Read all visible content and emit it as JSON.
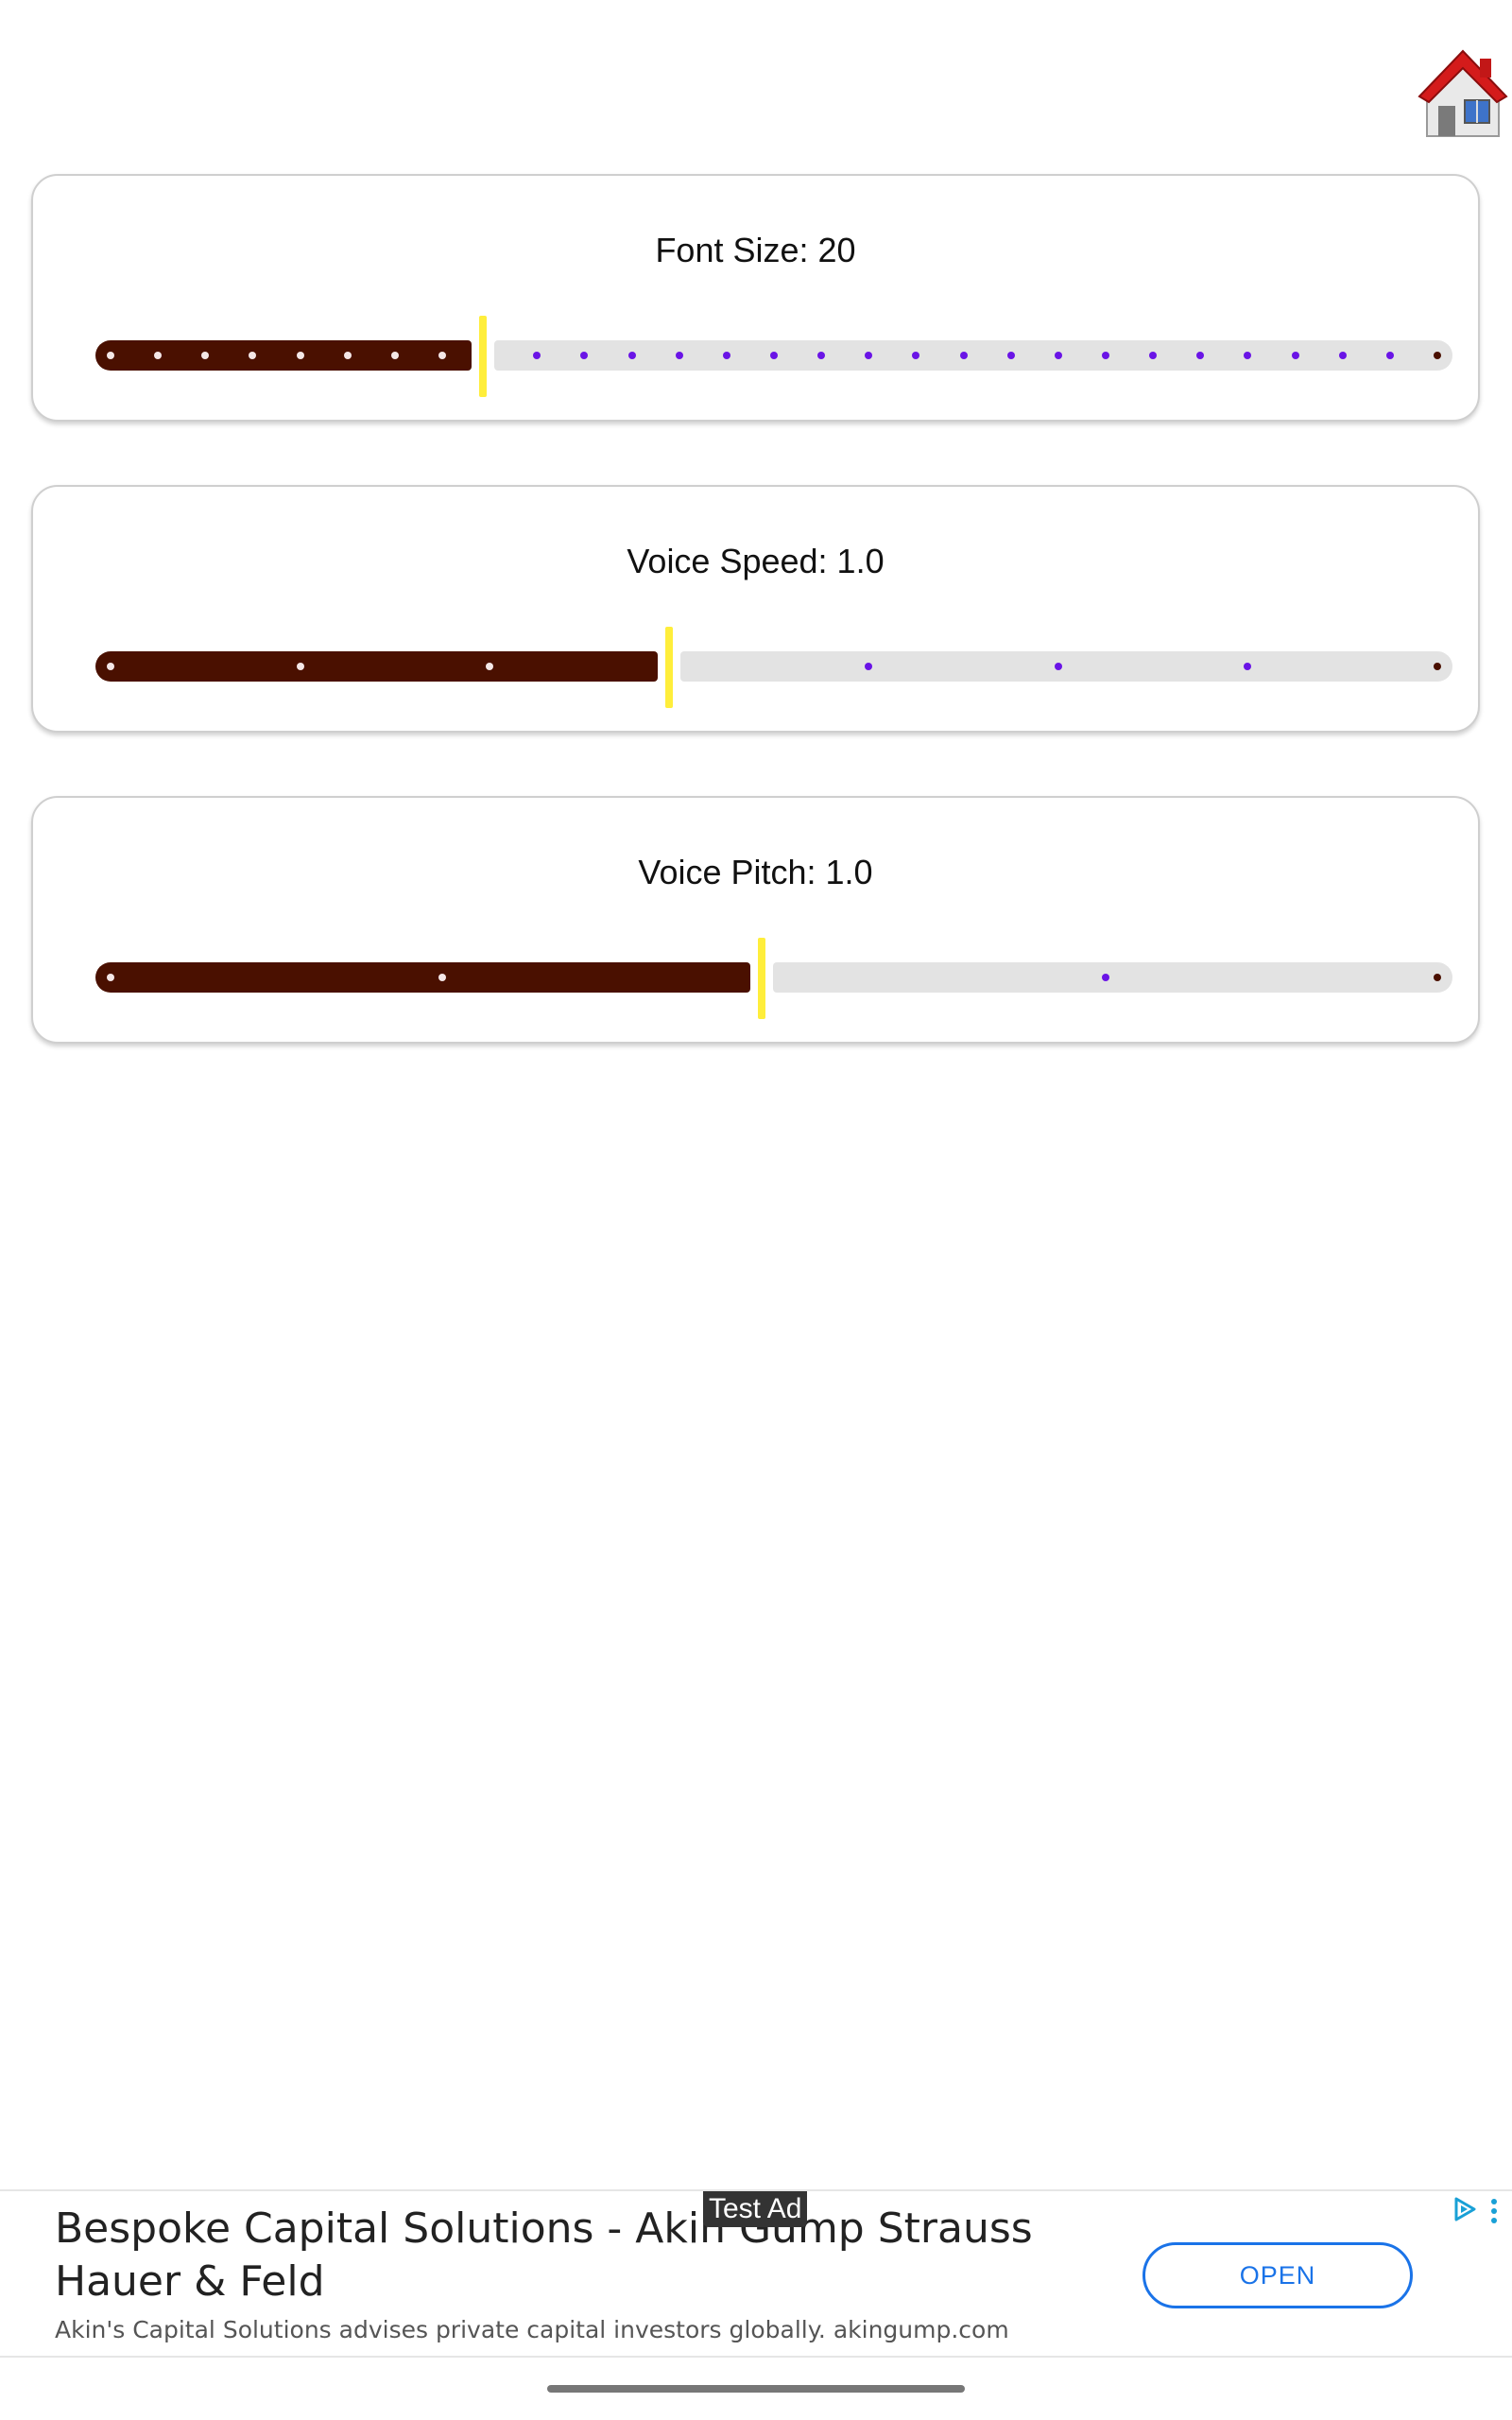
{
  "header": {
    "home_icon": "home-icon"
  },
  "settings": [
    {
      "label": "Font Size: 20",
      "value_fraction": 0.28,
      "steps": 28
    },
    {
      "label": "Voice Speed: 1.0",
      "value_fraction": 0.42,
      "steps": 7
    },
    {
      "label": "Voice Pitch: 1.0",
      "value_fraction": 0.49,
      "steps": 4
    }
  ],
  "colors": {
    "track_filled": "#4a1000",
    "track_empty": "#e3e3e3",
    "thumb": "#ffee3b",
    "tick_todo": "#6a14e6",
    "ad_accent": "#1a73e8"
  },
  "ad": {
    "badge": "Test Ad",
    "title": "Bespoke Capital Solutions - Akin Gump Strauss Hauer & Feld",
    "description": "Akin's Capital Solutions advises private capital investors globally. akingump.com",
    "cta": "OPEN"
  }
}
